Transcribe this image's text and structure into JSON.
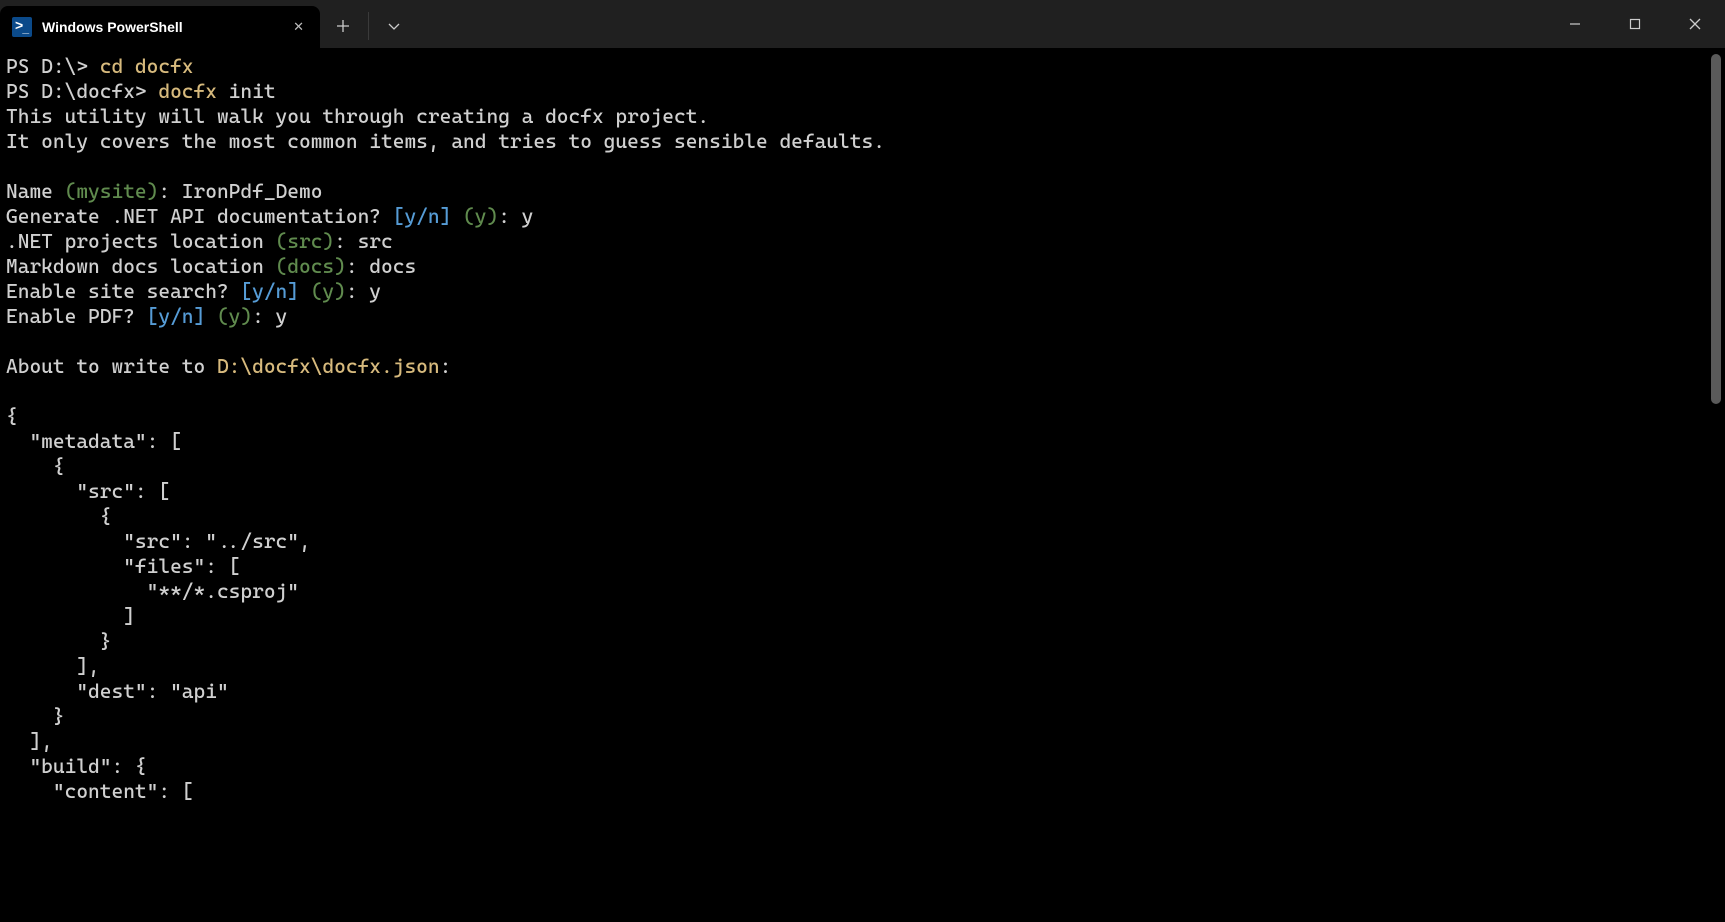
{
  "titlebar": {
    "tab_title": "Windows PowerShell",
    "new_tab": "+",
    "dropdown": "▾"
  },
  "term": {
    "line0_prompt": "PS D:\\> ",
    "line0_cmd": "cd docfx",
    "line1_prompt": "PS D:\\docfx> ",
    "line1_cmd": "docfx",
    "line1_arg": " init",
    "line2": "This utility will walk you through creating a docfx project.",
    "line3": "It only covers the most common items, and tries to guess sensible defaults.",
    "blank": "",
    "name_label": "Name ",
    "name_default": "(mysite)",
    "name_after": ": IronPdf_Demo",
    "gen_label": "Generate .NET API documentation? ",
    "yn": "[y/n]",
    "space": " ",
    "def_y": "(y)",
    "after_y": ": y",
    "net_label": ".NET projects location ",
    "net_default": "(src)",
    "net_after": ": src",
    "md_label": "Markdown docs location ",
    "md_default": "(docs)",
    "md_after": ": docs",
    "search_label": "Enable site search? ",
    "pdf_label": "Enable PDF? ",
    "about_prefix": "About to write to ",
    "about_path": "D:\\docfx\\docfx.json",
    "about_suffix": ":",
    "j1": "{",
    "j2": "  \"metadata\": [",
    "j3": "    {",
    "j4": "      \"src\": [",
    "j5": "        {",
    "j6": "          \"src\": \"../src\",",
    "j7": "          \"files\": [",
    "j8": "            \"**/*.csproj\"",
    "j9": "          ]",
    "j10": "        }",
    "j11": "      ],",
    "j12": "      \"dest\": \"api\"",
    "j13": "    }",
    "j14": "  ],",
    "j15": "  \"build\": {",
    "j16": "    \"content\": ["
  }
}
